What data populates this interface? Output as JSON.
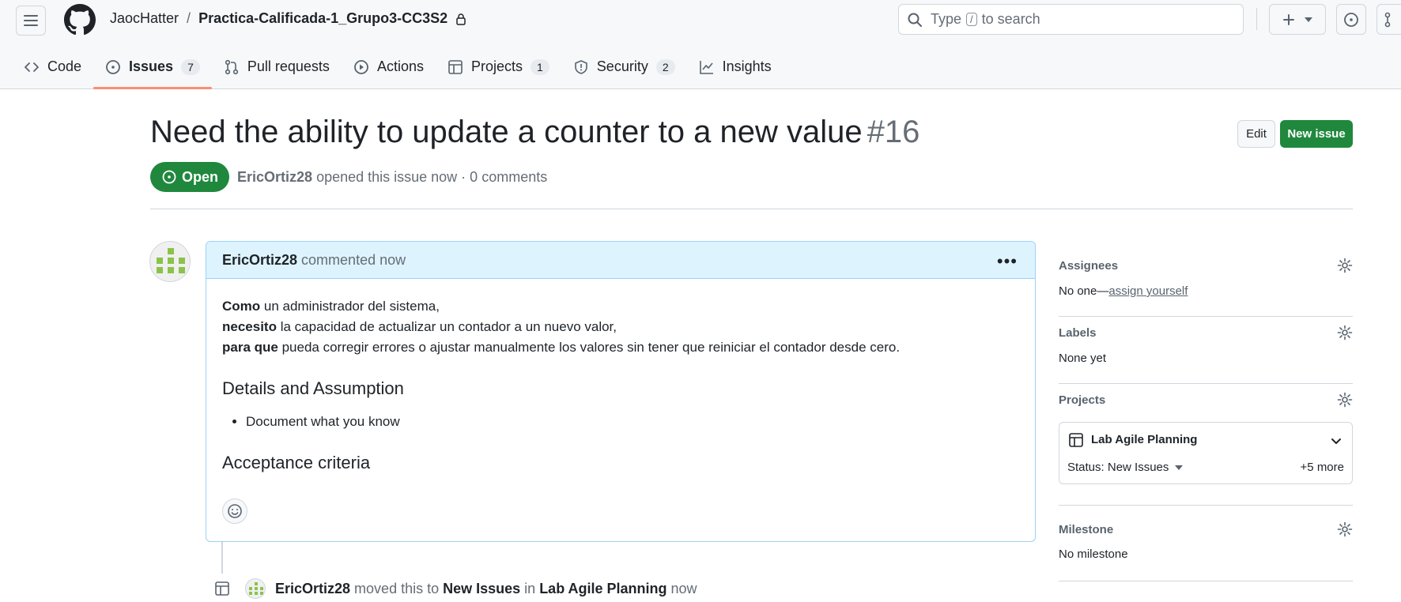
{
  "header": {
    "repo_owner": "JaocHatter",
    "repo_separator": "/",
    "repo_name": "Practica-Calificada-1_Grupo3-CC3S2",
    "search_placeholder_before": "Type",
    "search_kbd": "/",
    "search_placeholder_after": "to search"
  },
  "tabs": [
    {
      "label": "Code",
      "icon": "code-icon"
    },
    {
      "label": "Issues",
      "count": "7",
      "icon": "issue-opened-icon"
    },
    {
      "label": "Pull requests",
      "icon": "pull-request-icon"
    },
    {
      "label": "Actions",
      "icon": "play-icon"
    },
    {
      "label": "Projects",
      "count": "1",
      "icon": "table-icon"
    },
    {
      "label": "Security",
      "count": "2",
      "icon": "shield-icon"
    },
    {
      "label": "Insights",
      "icon": "graph-icon"
    }
  ],
  "issue": {
    "title": "Need the ability to update a counter to a new value",
    "number": "#16",
    "state": "Open",
    "author": "EricOrtiz28",
    "meta_rest": "opened this issue now · 0 comments",
    "edit_label": "Edit",
    "new_issue_label": "New issue"
  },
  "comment": {
    "author": "EricOrtiz28",
    "action": "commented now",
    "line1_bold": "Como",
    "line1_rest": " un administrador del sistema,",
    "line2_bold": "necesito",
    "line2_rest": " la capacidad de actualizar un contador a un nuevo valor,",
    "line3_bold": "para que",
    "line3_rest": " pueda corregir errores o ajustar manualmente los valores sin tener que reiniciar el contador desde cero.",
    "heading1": "Details and Assumption",
    "bullet1": "Document what you know",
    "heading2": "Acceptance criteria"
  },
  "timeline": {
    "author": "EricOrtiz28",
    "text1": " moved this to ",
    "column": "New Issues",
    "text2": " in ",
    "project": "Lab Agile Planning",
    "text3": " now"
  },
  "sidebar": {
    "assignees_title": "Assignees",
    "assignees_text": "No one—",
    "assignees_link": "assign yourself",
    "labels_title": "Labels",
    "labels_text": "None yet",
    "projects_title": "Projects",
    "project_name": "Lab Agile Planning",
    "project_status": "Status: New Issues",
    "project_more": "+5 more",
    "milestone_title": "Milestone",
    "milestone_text": "No milestone"
  },
  "colors": {
    "open_green": "#1f883d",
    "tab_underline": "#fd8c73",
    "comment_header_bg": "#ddf4ff",
    "comment_border": "#9cd1f7"
  }
}
